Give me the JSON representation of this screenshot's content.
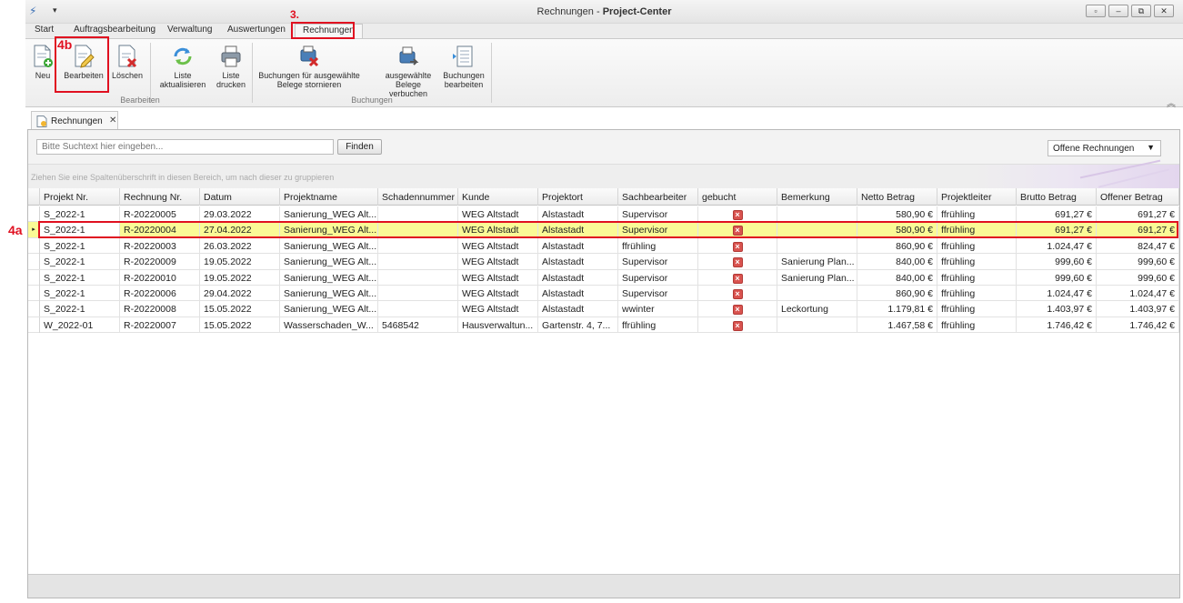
{
  "window": {
    "title_prefix": "Rechnungen -",
    "title_app": "Project-Center",
    "qat_symbol": "▾",
    "controls": [
      "▫",
      "–",
      "⧉",
      "✕"
    ]
  },
  "ribbon_tabs": [
    "Start",
    "Auftragsbearbeitung",
    "Verwaltung",
    "Auswertungen",
    "Rechnungen"
  ],
  "ribbon": {
    "buttons": {
      "neu": "Neu",
      "bearbeiten": "Bearbeiten",
      "loeschen": "Löschen",
      "liste_aktualisieren": [
        "Liste",
        "aktualisieren"
      ],
      "liste_drucken": [
        "Liste",
        "drucken"
      ],
      "stornieren": [
        "Buchungen für ausgewählte",
        "Belege stornieren"
      ],
      "verbuchen": [
        "ausgewählte",
        "Belege verbuchen"
      ],
      "buchungen_bearbeiten": [
        "Buchungen",
        "bearbeiten"
      ]
    },
    "groups": {
      "bearbeiten": "Bearbeiten",
      "buchungen": "Buchungen"
    },
    "collapse_symbol": "︽"
  },
  "document_tab": {
    "label": "Rechnungen",
    "close": "✕"
  },
  "search": {
    "placeholder": "Bitte Suchtext hier eingeben...",
    "find_label": "Finden"
  },
  "filter": {
    "selected": "Offene Rechnungen",
    "arrow": "▼"
  },
  "group_hint": "Ziehen Sie eine Spaltenüberschrift in diesen Bereich, um nach dieser zu gruppieren",
  "columns": [
    "Projekt Nr.",
    "Rechnung Nr.",
    "Datum",
    "Projektname",
    "Schadennummer",
    "Kunde",
    "Projektort",
    "Sachbearbeiter",
    "gebucht",
    "Bemerkung",
    "Netto Betrag",
    "Projektleiter",
    "Brutto Betrag",
    "Offener Betrag"
  ],
  "rows": [
    [
      "S_2022-1",
      "R-20220005",
      "29.03.2022",
      "Sanierung_WEG Alt...",
      "",
      "WEG Altstadt",
      "Alstastadt",
      "Supervisor",
      "x",
      "",
      "580,90 €",
      "ffrühling",
      "691,27 €",
      "691,27 €"
    ],
    [
      "S_2022-1",
      "R-20220004",
      "27.04.2022",
      "Sanierung_WEG Alt...",
      "",
      "WEG Altstadt",
      "Alstastadt",
      "Supervisor",
      "x",
      "",
      "580,90 €",
      "ffrühling",
      "691,27 €",
      "691,27 €"
    ],
    [
      "S_2022-1",
      "R-20220003",
      "26.03.2022",
      "Sanierung_WEG Alt...",
      "",
      "WEG Altstadt",
      "Alstastadt",
      "ffrühling",
      "x",
      "",
      "860,90 €",
      "ffrühling",
      "1.024,47 €",
      "824,47 €"
    ],
    [
      "S_2022-1",
      "R-20220009",
      "19.05.2022",
      "Sanierung_WEG Alt...",
      "",
      "WEG Altstadt",
      "Alstastadt",
      "Supervisor",
      "x",
      "Sanierung Plan...",
      "840,00 €",
      "ffrühling",
      "999,60 €",
      "999,60 €"
    ],
    [
      "S_2022-1",
      "R-20220010",
      "19.05.2022",
      "Sanierung_WEG Alt...",
      "",
      "WEG Altstadt",
      "Alstastadt",
      "Supervisor",
      "x",
      "Sanierung Plan...",
      "840,00 €",
      "ffrühling",
      "999,60 €",
      "999,60 €"
    ],
    [
      "S_2022-1",
      "R-20220006",
      "29.04.2022",
      "Sanierung_WEG Alt...",
      "",
      "WEG Altstadt",
      "Alstastadt",
      "Supervisor",
      "x",
      "",
      "860,90 €",
      "ffrühling",
      "1.024,47 €",
      "1.024,47 €"
    ],
    [
      "S_2022-1",
      "R-20220008",
      "15.05.2022",
      "Sanierung_WEG Alt...",
      "",
      "WEG Altstadt",
      "Alstastadt",
      "wwinter",
      "x",
      "Leckortung",
      "1.179,81 €",
      "ffrühling",
      "1.403,97 €",
      "1.403,97 €"
    ],
    [
      "W_2022-01",
      "R-20220007",
      "15.05.2022",
      "Wasserschaden_W...",
      "5468542",
      "Hausverwaltun...",
      "Gartenstr. 4, 7...",
      "ffrühling",
      "x",
      "",
      "1.467,58 €",
      "ffrühling",
      "1.746,42 €",
      "1.746,42 €"
    ]
  ],
  "focused_row_index": 1,
  "focused_row_marker": "▸",
  "annotations": {
    "step_3": "3.",
    "step_4a": "4a",
    "step_4b": "4b",
    "color": "#e01020"
  },
  "colors": {
    "focused_row": "#fafa96",
    "booked_no": "#d9534f"
  }
}
